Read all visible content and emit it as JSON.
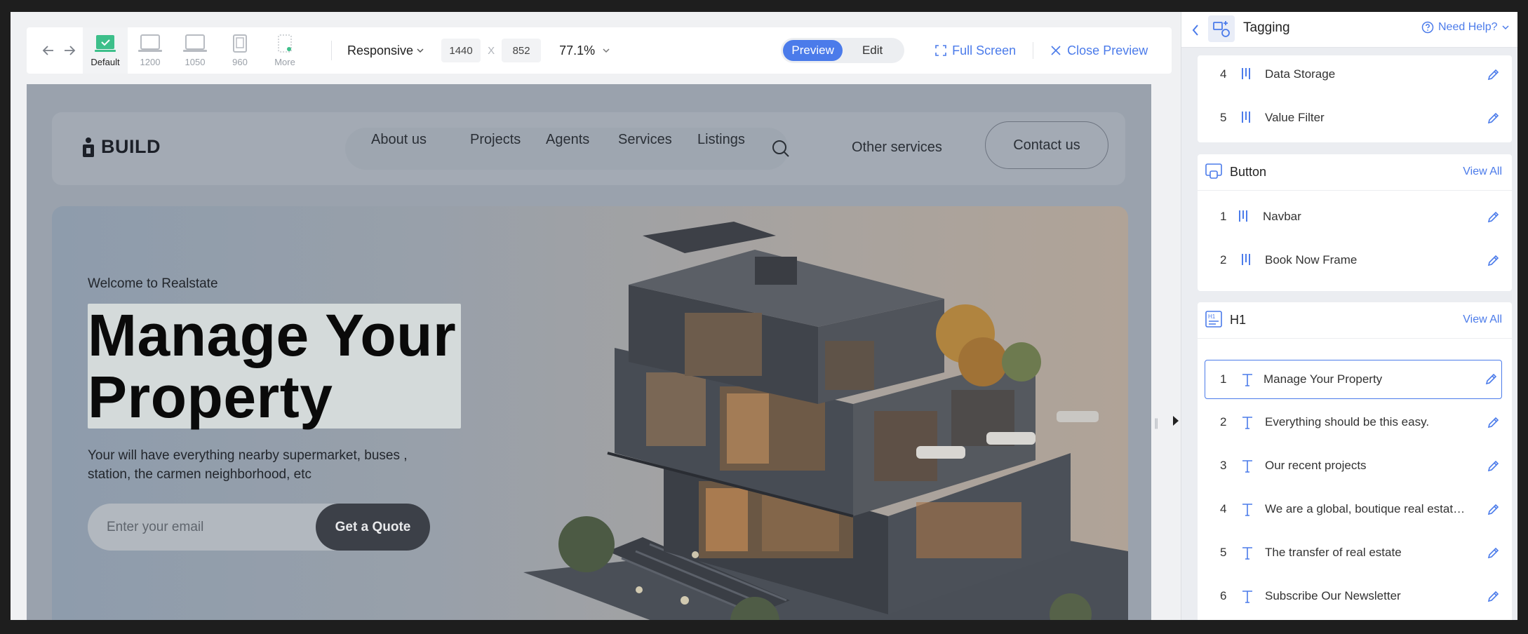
{
  "toolbar": {
    "devices": [
      {
        "label": "Default",
        "active": true
      },
      {
        "label": "1200"
      },
      {
        "label": "1050"
      },
      {
        "label": "960"
      },
      {
        "label": "More"
      }
    ],
    "responsive_label": "Responsive",
    "width_value": "1440",
    "height_value": "852",
    "dim_separator": "X",
    "zoom": "77.1%",
    "mode_preview": "Preview",
    "mode_edit": "Edit",
    "full_screen": "Full Screen",
    "close_preview": "Close Preview",
    "accent_color": "#4b7bea"
  },
  "site": {
    "logo_text": "BUILD",
    "nav": [
      "About us",
      "Projects",
      "Agents",
      "Services",
      "Listings"
    ],
    "other_services": "Other services",
    "contact": "Contact us",
    "hero": {
      "welcome": "Welcome to Realstate",
      "title_line1": "Manage Your",
      "title_line2": "Property",
      "subtitle": "Your will have everything nearby supermarket, buses , station, the carmen neighborhood, etc",
      "email_placeholder": "Enter your email",
      "cta": "Get a Quote"
    }
  },
  "panel": {
    "title": "Tagging",
    "help": "Need Help?",
    "top_group": {
      "rows": [
        {
          "num": "4",
          "label": "Data Storage",
          "icon": "component-icon"
        },
        {
          "num": "5",
          "label": "Value Filter",
          "icon": "component-icon"
        }
      ]
    },
    "button_group": {
      "title": "Button",
      "view_all": "View All",
      "rows": [
        {
          "num": "1",
          "label": "Navbar",
          "icon": "component-icon"
        },
        {
          "num": "2",
          "label": "Book Now Frame",
          "icon": "component-icon"
        }
      ]
    },
    "h1_group": {
      "title": "H1",
      "view_all": "View All",
      "rows": [
        {
          "num": "1",
          "label": "Manage Your Property",
          "icon": "text-icon",
          "selected": true
        },
        {
          "num": "2",
          "label": "Everything should be this easy.",
          "icon": "text-icon"
        },
        {
          "num": "3",
          "label": "Our recent projects",
          "icon": "text-icon"
        },
        {
          "num": "4",
          "label": "We are a global, boutique real estate brokerage",
          "icon": "text-icon"
        },
        {
          "num": "5",
          "label": "The transfer of real estate",
          "icon": "text-icon"
        },
        {
          "num": "6",
          "label": "Subscribe Our Newsletter",
          "icon": "text-icon"
        }
      ]
    }
  }
}
